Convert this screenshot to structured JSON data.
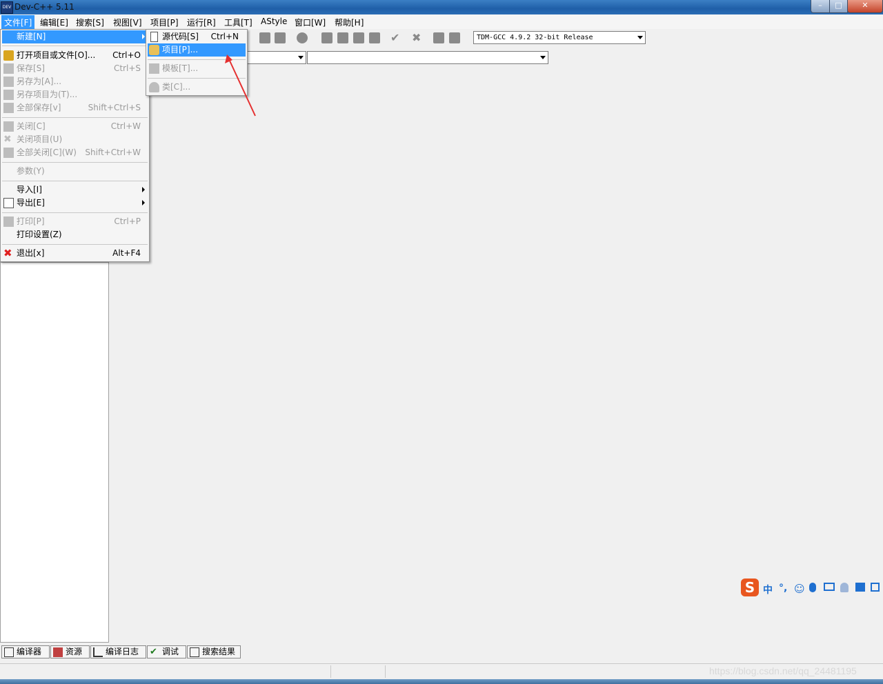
{
  "window": {
    "title": "Dev-C++ 5.11",
    "app_icon_text": "DEV",
    "controls": {
      "minimize": "–",
      "maximize": "□",
      "close": "✕"
    }
  },
  "menubar": {
    "items": [
      {
        "label": "文件[F]",
        "active": true
      },
      {
        "label": "编辑[E]"
      },
      {
        "label": "搜索[S]"
      },
      {
        "label": "视图[V]"
      },
      {
        "label": "项目[P]"
      },
      {
        "label": "运行[R]"
      },
      {
        "label": "工具[T]"
      },
      {
        "label": "AStyle"
      },
      {
        "label": "窗口[W]"
      },
      {
        "label": "帮助[H]"
      }
    ]
  },
  "toolbar": {
    "compiler_select": "TDM-GCC 4.9.2 32-bit Release"
  },
  "file_menu": {
    "items": [
      {
        "label": "新建[N]",
        "shortcut": "",
        "highlight": true,
        "submenu": true
      },
      {
        "label": "打开项目或文件[O]...",
        "shortcut": "Ctrl+O"
      },
      {
        "label": "保存[S]",
        "shortcut": "Ctrl+S",
        "disabled": true
      },
      {
        "label": "另存为[A]...",
        "shortcut": "",
        "disabled": true
      },
      {
        "label": "另存项目为(T)...",
        "shortcut": "",
        "disabled": true
      },
      {
        "label": "全部保存[v]",
        "shortcut": "Shift+Ctrl+S",
        "disabled": true
      },
      {
        "label": "关闭[C]",
        "shortcut": "Ctrl+W",
        "disabled": true
      },
      {
        "label": "关闭项目(U)",
        "shortcut": "",
        "disabled": true
      },
      {
        "label": "全部关闭[C](W)",
        "shortcut": "Shift+Ctrl+W",
        "disabled": true
      },
      {
        "label": "参数(Y)",
        "shortcut": "",
        "disabled": true
      },
      {
        "label": "导入[I]",
        "shortcut": "",
        "submenu": true
      },
      {
        "label": "导出[E]",
        "shortcut": "",
        "submenu": true
      },
      {
        "label": "打印[P]",
        "shortcut": "Ctrl+P",
        "disabled": true
      },
      {
        "label": "打印设置(Z)",
        "shortcut": ""
      },
      {
        "label": "退出[x]",
        "shortcut": "Alt+F4"
      }
    ]
  },
  "new_submenu": {
    "items": [
      {
        "label": "源代码[S]",
        "shortcut": "Ctrl+N"
      },
      {
        "label": "项目[P]...",
        "shortcut": "",
        "highlight": true
      },
      {
        "label": "模板[T]...",
        "shortcut": "",
        "disabled": true
      },
      {
        "label": "类[C]...",
        "shortcut": "",
        "disabled": true
      }
    ]
  },
  "bottom_tabs": [
    {
      "label": "编译器"
    },
    {
      "label": "资源"
    },
    {
      "label": "编译日志"
    },
    {
      "label": "调试"
    },
    {
      "label": "搜索结果"
    }
  ],
  "ime_bar": {
    "logo": "S",
    "items": [
      "中",
      "°,"
    ]
  },
  "watermark": "https://blog.csdn.net/qq_24481195",
  "colors": {
    "highlight": "#3399ff",
    "arrow": "#e53030",
    "ime_logo": "#e8561f"
  }
}
